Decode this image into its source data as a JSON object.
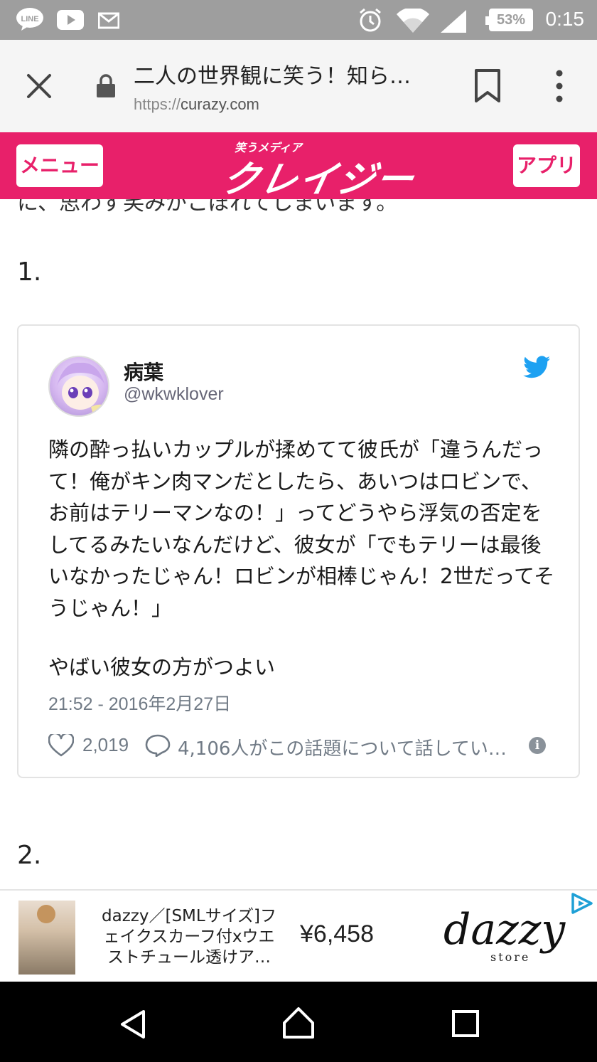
{
  "status_bar": {
    "time": "0:15",
    "battery": "53%",
    "left_icons": [
      "line-icon",
      "youtube-icon",
      "mail-icon"
    ],
    "right_icons": [
      "alarm-icon",
      "wifi-icon",
      "signal-icon"
    ]
  },
  "browser": {
    "title": "二人の世界観に笑う！知ら…",
    "url_scheme": "https://",
    "url_host": "curazy.com"
  },
  "site_header": {
    "menu_label": "メニュー",
    "logo_sub": "笑うメディア",
    "logo_main": "クレイジー",
    "app_label": "アプリ",
    "bg_color": "#e8206a"
  },
  "article": {
    "cut_text": "に、思わず笑みがこぼれてしまいます。",
    "item1_number": "1.",
    "item2_number": "2.",
    "tweet": {
      "name": "病葉",
      "handle": "@wkwklover",
      "text": "隣の酔っ払いカップルが揉めてて彼氏が「違うんだって！俺がキン肉マンだとしたら、あいつはロビンで、お前はテリーマンなの！」ってどうやら浮気の否定をしてるみたいなんだけど、彼女が「でもテリーは最後いなかったじゃん！ロビンが相棒じゃん！2世だってそうじゃん！」",
      "footnote": "やばい彼女の方がつよい",
      "timestamp": "21:52 - 2016年2月27日",
      "likes": "2,019",
      "conversation": "4,106人がこの話題について話してい…",
      "info_glyph": "i"
    }
  },
  "ad": {
    "description": "dazzy／[SMLサイズ]フェイクスカーフ付xウエストチュール透けア…",
    "price": "¥6,458",
    "brand": "dazzy",
    "brand_sub": "store"
  }
}
